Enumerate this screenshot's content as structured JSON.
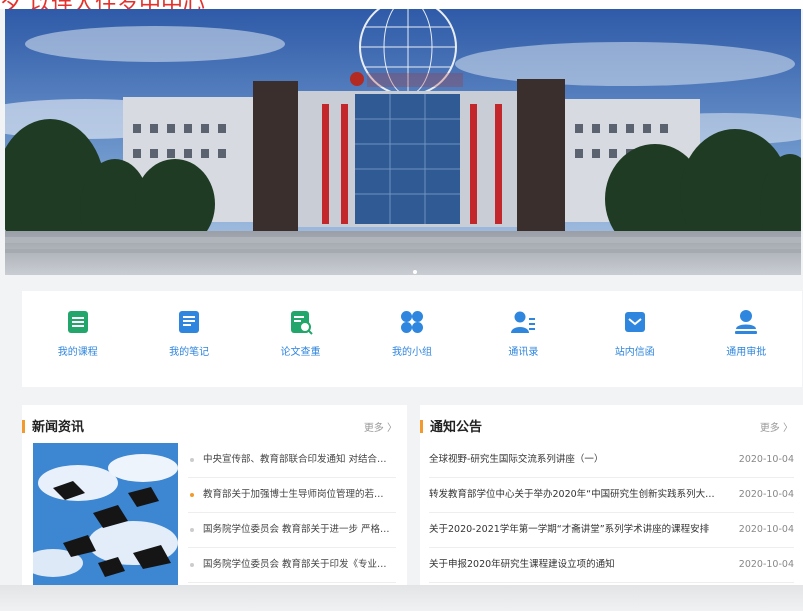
{
  "header": {
    "title_fragment": "夕 以连人住岁中中心"
  },
  "shortcuts": [
    {
      "label": "我的课程",
      "icon": "course-book-icon"
    },
    {
      "label": "我的笔记",
      "icon": "notes-icon"
    },
    {
      "label": "论文查重",
      "icon": "paper-check-icon"
    },
    {
      "label": "我的小组",
      "icon": "group-icon"
    },
    {
      "label": "通讯录",
      "icon": "contacts-icon"
    },
    {
      "label": "站内信函",
      "icon": "mail-icon"
    },
    {
      "label": "通用审批",
      "icon": "approval-icon"
    }
  ],
  "news": {
    "title": "新闻资讯",
    "more": "更多 〉",
    "items": [
      "中央宣传部、教育部联合印发通知 对结合…",
      "教育部关于加强博士生导师岗位管理的若…",
      "国务院学位委员会 教育部关于进一步 严格…",
      "国务院学位委员会 教育部关于印发《专业…"
    ]
  },
  "notice": {
    "title": "通知公告",
    "more": "更多 〉",
    "items": [
      {
        "title": "全球视野-研究生国际交流系列讲座（一）",
        "date": "2020-10-04"
      },
      {
        "title": "转发教育部学位中心关于举办2020年“中国研究生创新实践系列大…",
        "date": "2020-10-04"
      },
      {
        "title": "关于2020-2021学年第一学期“才斋讲堂”系列学术讲座的课程安排",
        "date": "2020-10-04"
      },
      {
        "title": "关于申报2020年研究生课程建设立项的通知",
        "date": "2020-10-04"
      }
    ]
  },
  "colors": {
    "accent_blue": "#2f86de",
    "accent_orange": "#f29a2e",
    "header_red": "#e5312b"
  }
}
